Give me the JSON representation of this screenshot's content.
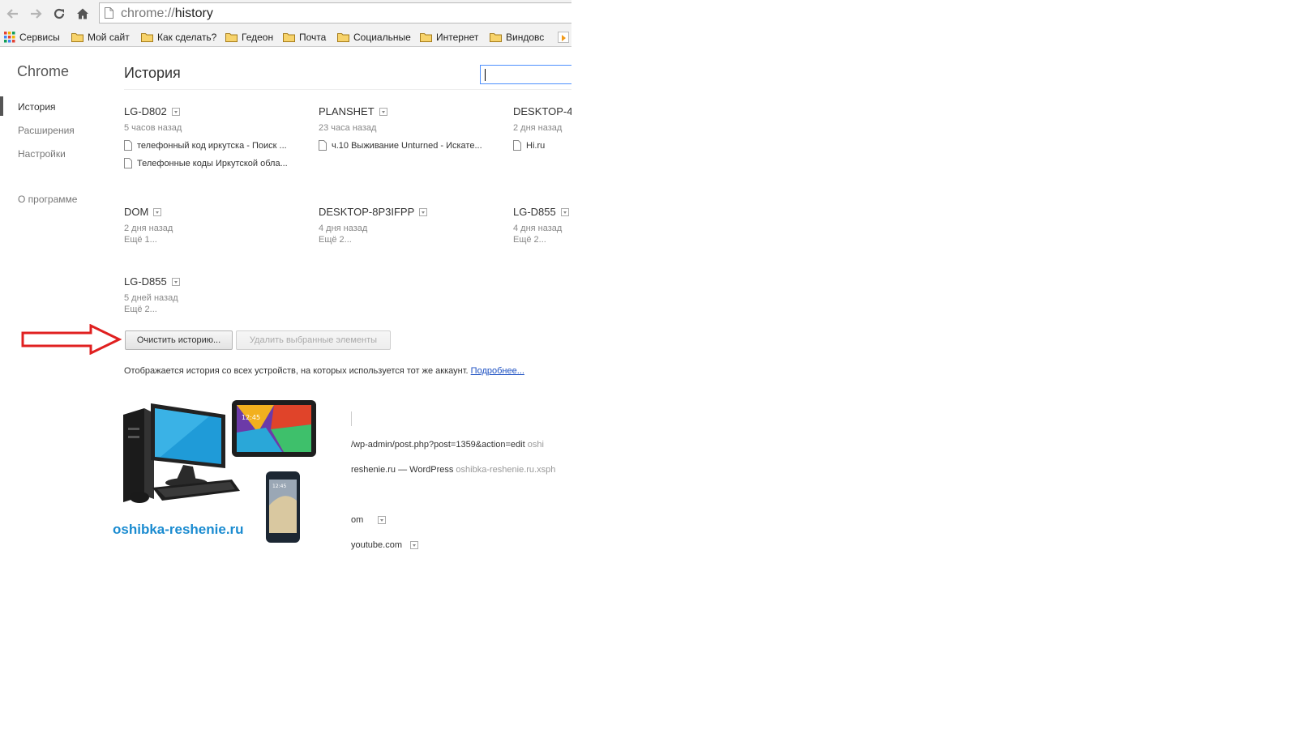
{
  "browser": {
    "url_prefix": "chrome://",
    "url_path": "history",
    "bookmarks": [
      "Сервисы",
      "Мой сайт",
      "Как сделать?",
      "Гедеон",
      "Почта",
      "Социальные",
      "Интернет",
      "Виндовс"
    ]
  },
  "sidebar": {
    "brand": "Chrome",
    "items": [
      "История",
      "Расширения",
      "Настройки"
    ],
    "about": "О программе"
  },
  "header": {
    "title": "История",
    "search_value": ""
  },
  "devices": [
    {
      "name": "LG-D802",
      "time": "5 часов назад",
      "entries": [
        "телефонный код иркутска - Поиск ...",
        "Телефонные коды Иркутской обла..."
      ]
    },
    {
      "name": "PLANSHET",
      "time": "23 часа назад",
      "entries": [
        "ч.10 Выживание Unturned - Искате..."
      ]
    },
    {
      "name": "DESKTOP-4",
      "time": "2 дня назад",
      "entries": [
        "Hi.ru"
      ]
    },
    {
      "name": "DOM",
      "time": "2 дня назад",
      "more": "Ещё 1..."
    },
    {
      "name": "DESKTOP-8P3IFPP",
      "time": "4 дня назад",
      "more": "Ещё 2..."
    },
    {
      "name": "LG-D855",
      "time": "4 дня назад",
      "more": "Ещё 2..."
    },
    {
      "name": "LG-D855",
      "time": "5 дней назад",
      "more": "Ещё 2..."
    }
  ],
  "actions": {
    "clear": "Очистить историю...",
    "remove": "Удалить выбранные элементы"
  },
  "info": {
    "text": "Отображается история со всех устройств, на которых используется тот же аккаунт.",
    "link": "Подробнее..."
  },
  "peek": {
    "row1": "/wp-admin/post.php?post=1359&action=edit",
    "row1_dim": "oshi",
    "row2": "reshenie.ru — WordPress",
    "row2_dim": "oshibka-reshenie.ru.xsph",
    "row3": "om",
    "row4": "youtube.com"
  },
  "watermark": "oshibka-reshenie.ru",
  "colors": {
    "accent": "#4d90fe",
    "link": "#1a4ec1",
    "arrow": "#e02020",
    "watermark": "#1a8bd0"
  }
}
